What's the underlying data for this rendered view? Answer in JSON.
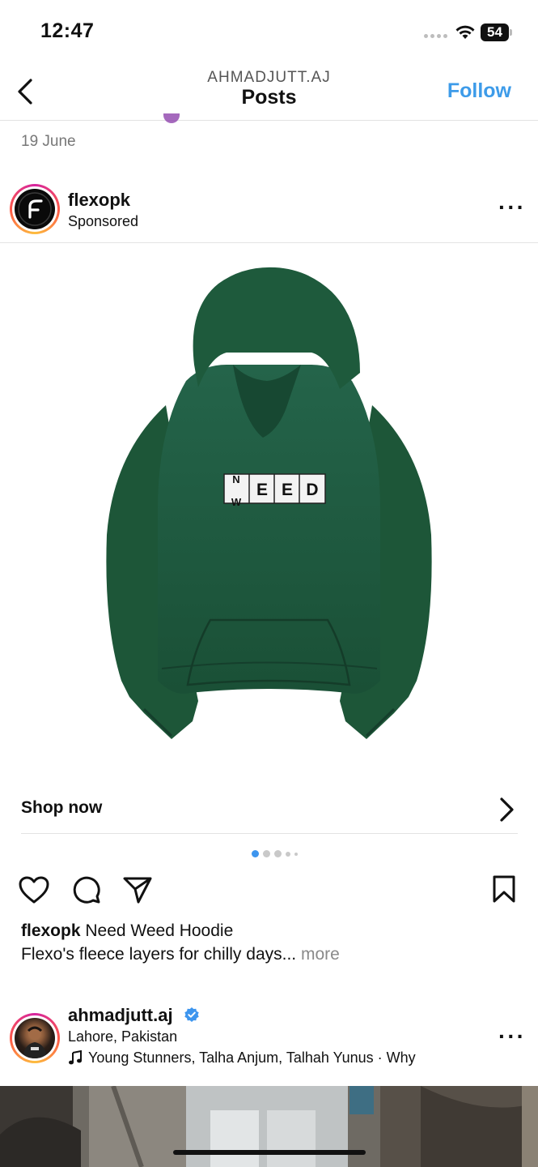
{
  "status": {
    "time": "12:47",
    "battery": "54"
  },
  "header": {
    "username": "AHMADJUTT.AJ",
    "title": "Posts",
    "follow_label": "Follow"
  },
  "prev_post": {
    "date": "19 June"
  },
  "ad_post": {
    "username": "flexopk",
    "subtitle": "Sponsored",
    "print_top": "N",
    "print_bottom": "W",
    "print_letters": [
      "E",
      "E",
      "D"
    ],
    "shop_label": "Shop now",
    "caption_user": "flexopk",
    "caption_text": " Need Weed Hoodie",
    "caption_line2": "Flexo's fleece layers for chilly days...",
    "more_label": " more",
    "hoodie_color": "#1e5a3c",
    "carousel_total": 5,
    "carousel_active": 1
  },
  "next_post": {
    "username": "ahmadjutt.aj",
    "location": "Lahore, Pakistan",
    "music": "Young Stunners, Talha Anjum, Talhah Yunus · Why"
  },
  "colors": {
    "accent": "#3d9be9",
    "verified": "#3d95ee"
  }
}
